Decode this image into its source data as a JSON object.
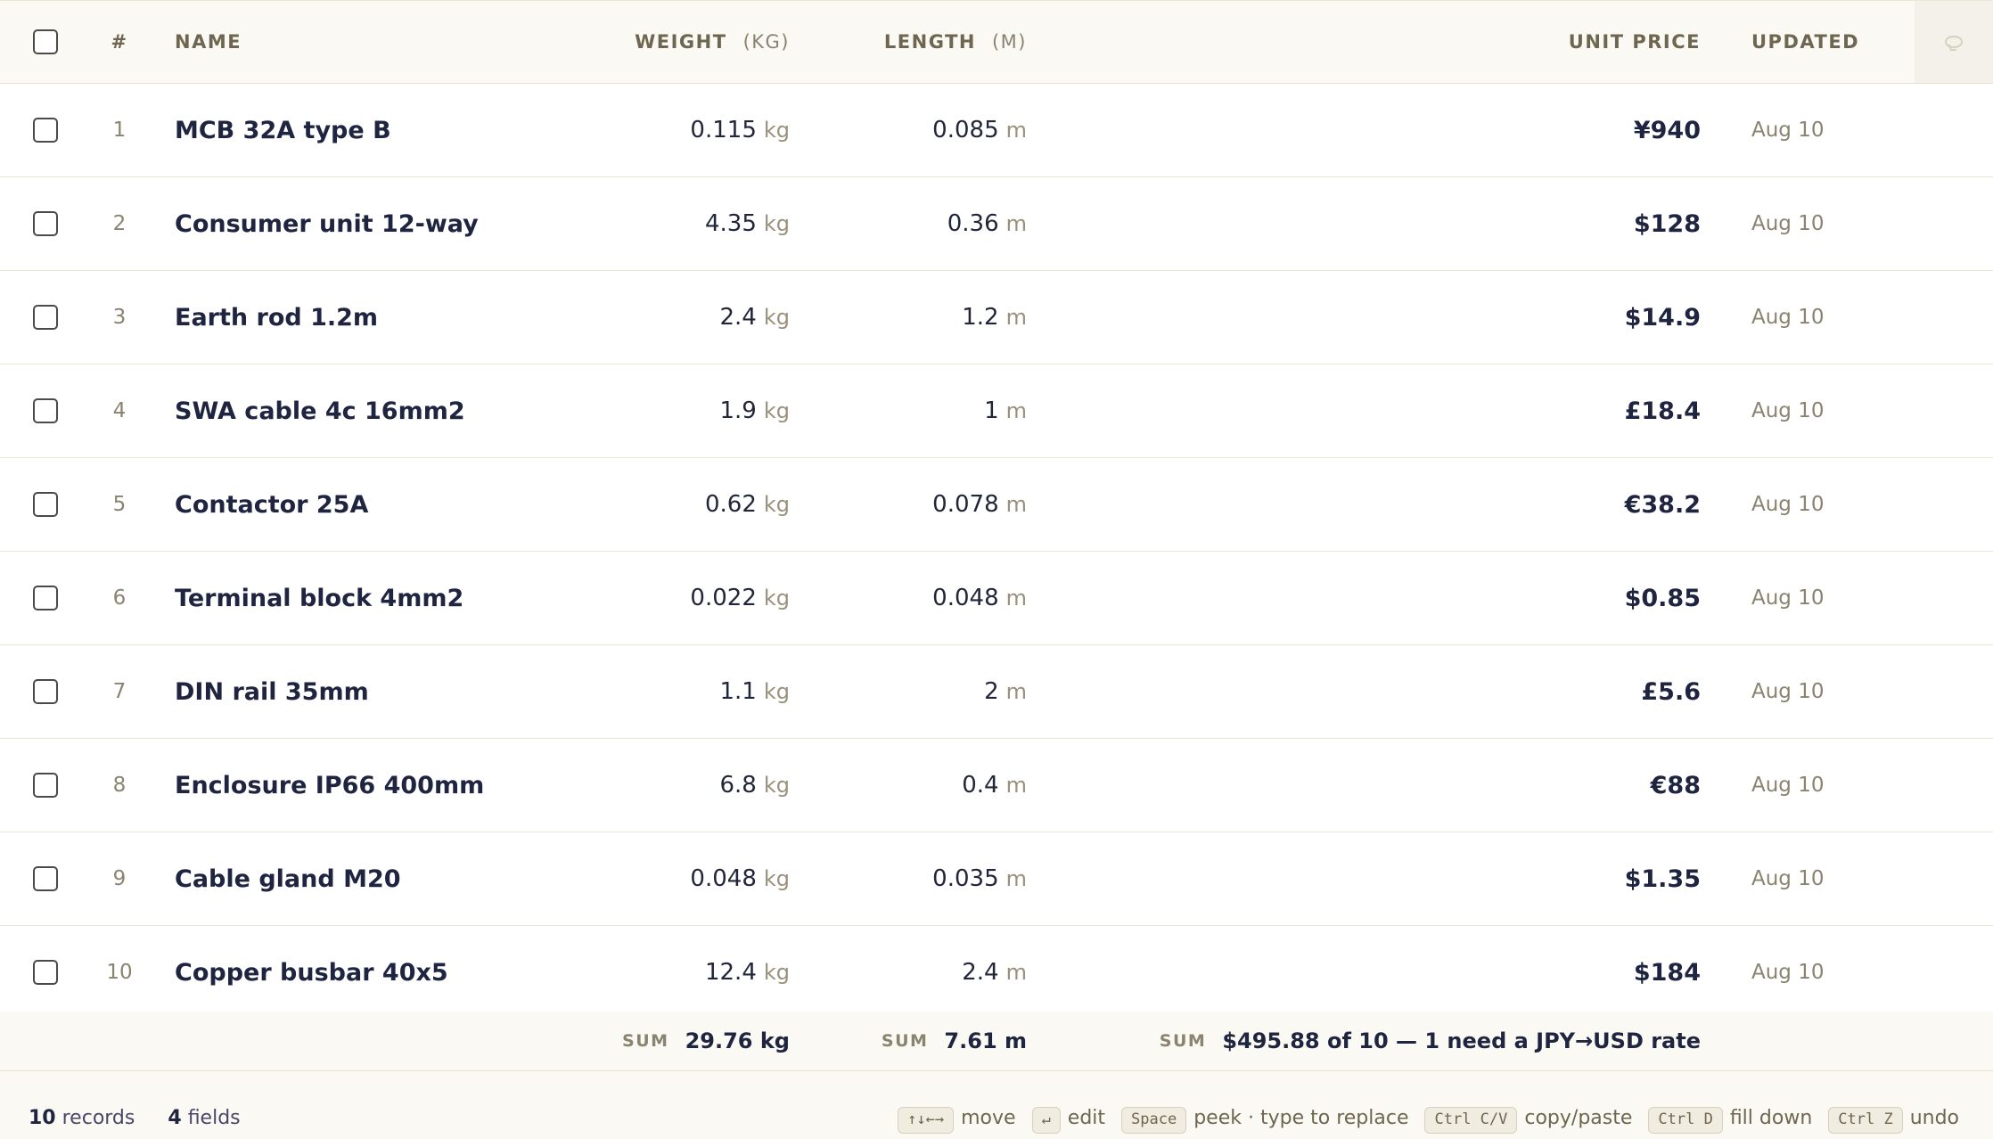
{
  "header": {
    "index": "#",
    "name": "NAME",
    "weight": "WEIGHT",
    "weight_unit": "(KG)",
    "length": "LENGTH",
    "length_unit": "(M)",
    "unit_price": "UNIT PRICE",
    "updated": "UPDATED",
    "comment_icon": "comment-icon"
  },
  "rows": [
    {
      "index": "1",
      "name": "MCB 32A type B",
      "weight": "0.115",
      "weight_unit": "kg",
      "length": "0.085",
      "length_unit": "m",
      "price": "¥940",
      "updated": "Aug 10"
    },
    {
      "index": "2",
      "name": "Consumer unit 12-way",
      "weight": "4.35",
      "weight_unit": "kg",
      "length": "0.36",
      "length_unit": "m",
      "price": "$128",
      "updated": "Aug 10"
    },
    {
      "index": "3",
      "name": "Earth rod 1.2m",
      "weight": "2.4",
      "weight_unit": "kg",
      "length": "1.2",
      "length_unit": "m",
      "price": "$14.9",
      "updated": "Aug 10"
    },
    {
      "index": "4",
      "name": "SWA cable 4c 16mm2",
      "weight": "1.9",
      "weight_unit": "kg",
      "length": "1",
      "length_unit": "m",
      "price": "£18.4",
      "updated": "Aug 10"
    },
    {
      "index": "5",
      "name": "Contactor 25A",
      "weight": "0.62",
      "weight_unit": "kg",
      "length": "0.078",
      "length_unit": "m",
      "price": "€38.2",
      "updated": "Aug 10"
    },
    {
      "index": "6",
      "name": "Terminal block 4mm2",
      "weight": "0.022",
      "weight_unit": "kg",
      "length": "0.048",
      "length_unit": "m",
      "price": "$0.85",
      "updated": "Aug 10"
    },
    {
      "index": "7",
      "name": "DIN rail 35mm",
      "weight": "1.1",
      "weight_unit": "kg",
      "length": "2",
      "length_unit": "m",
      "price": "£5.6",
      "updated": "Aug 10"
    },
    {
      "index": "8",
      "name": "Enclosure IP66 400mm",
      "weight": "6.8",
      "weight_unit": "kg",
      "length": "0.4",
      "length_unit": "m",
      "price": "€88",
      "updated": "Aug 10"
    },
    {
      "index": "9",
      "name": "Cable gland M20",
      "weight": "0.048",
      "weight_unit": "kg",
      "length": "0.035",
      "length_unit": "m",
      "price": "$1.35",
      "updated": "Aug 10"
    },
    {
      "index": "10",
      "name": "Copper busbar 40x5",
      "weight": "12.4",
      "weight_unit": "kg",
      "length": "2.4",
      "length_unit": "m",
      "price": "$184",
      "updated": "Aug 10"
    }
  ],
  "footer": {
    "sum_label": "SUM",
    "weight_sum": "29.76 kg",
    "length_sum": "7.61 m",
    "price_sum": "$495.88 of 10 — 1 need a JPY→USD rate"
  },
  "status": {
    "records": "10",
    "records_label": "records",
    "fields": "4",
    "fields_label": "fields",
    "shortcuts": [
      {
        "key": "↑↓←→",
        "label": "move"
      },
      {
        "key": "↵",
        "label": "edit"
      },
      {
        "key": "Space",
        "label": "peek · type to replace"
      },
      {
        "key": "Ctrl C/V",
        "label": "copy/paste"
      },
      {
        "key": "Ctrl D",
        "label": "fill down"
      },
      {
        "key": "Ctrl Z",
        "label": "undo"
      }
    ]
  }
}
